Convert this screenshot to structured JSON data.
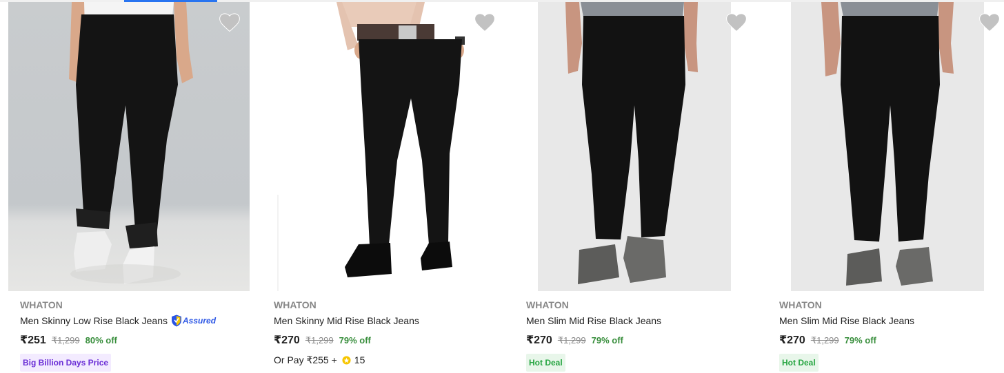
{
  "products": [
    {
      "brand": "WHATON",
      "title": "Men Skinny Low Rise Black Jeans",
      "assured_label": "Assured",
      "price": "₹251",
      "mrp": "₹1,299",
      "discount": "80% off",
      "badge": "Big Billion Days Price"
    },
    {
      "brand": "WHATON",
      "title": "Men Skinny Mid Rise Black Jeans",
      "price": "₹270",
      "mrp": "₹1,299",
      "discount": "79% off",
      "pay_prefix": "Or Pay ₹255 +",
      "pay_coins": "15"
    },
    {
      "brand": "WHATON",
      "title": "Men Slim Mid Rise Black Jeans",
      "price": "₹270",
      "mrp": "₹1,299",
      "discount": "79% off",
      "badge": "Hot Deal"
    },
    {
      "brand": "WHATON",
      "title": "Men Slim Mid Rise Black Jeans",
      "price": "₹270",
      "mrp": "₹1,299",
      "discount": "79% off",
      "badge": "Hot Deal"
    }
  ],
  "colors": {
    "price_green": "#388e3c",
    "assured_blue": "#2a55e5",
    "bbd_purple": "#6a2ed6",
    "hot_deal_green": "#26a541"
  },
  "icons": {
    "wishlist": "heart-icon",
    "assured": "assured-shield-icon",
    "coin": "supercoin-icon"
  }
}
